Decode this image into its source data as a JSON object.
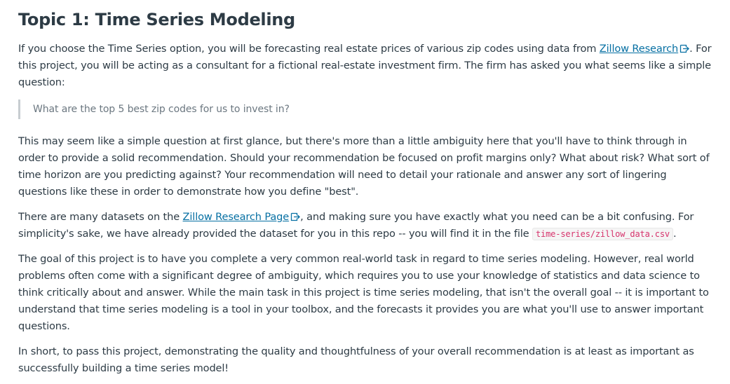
{
  "title": "Topic 1: Time Series Modeling",
  "intro": {
    "before_link": "If you choose the Time Series option, you will be forecasting real estate prices of various zip codes using data from ",
    "link_text": "Zillow Research",
    "after_link": ". For this project, you will be acting as a consultant for a fictional real-estate investment firm. The firm has asked you what seems like a simple question:"
  },
  "quote": "What are the top 5 best zip codes for us to invest in?",
  "paragraph_ambiguity": "This may seem like a simple question at first glance, but there's more than a little ambiguity here that you'll have to think through in order to provide a solid recommendation. Should your recommendation be focused on profit margins only? What about risk? What sort of time horizon are you predicting against? Your recommendation will need to detail your rationale and answer any sort of lingering questions like these in order to demonstrate how you define \"best\".",
  "datasets": {
    "before_link": "There are many datasets on the ",
    "link_text": "Zillow Research Page",
    "after_link": ", and making sure you have exactly what you need can be a bit confusing. For simplicity's sake, we have already provided the dataset for you in this repo -- you will find it in the file ",
    "code": "time-series/zillow_data.csv",
    "end": "."
  },
  "paragraph_goal": "The goal of this project is to have you complete a very common real-world task in regard to time series modeling. However, real world problems often come with a significant degree of ambiguity, which requires you to use your knowledge of statistics and data science to think critically about and answer. While the main task in this project is time series modeling, that isn't the overall goal -- it is important to understand that time series modeling is a tool in your toolbox, and the forecasts it provides you are what you'll use to answer important questions.",
  "paragraph_short": "In short, to pass this project, demonstrating the quality and thoughtfulness of your overall recommendation is at least as important as successfully building a time series model!",
  "icons": {
    "external_link": "external-link-icon"
  },
  "colors": {
    "text": "#2d3b45",
    "link": "#0770a3",
    "quote_text": "#6b7780",
    "quote_border": "#c7cdd1",
    "code_text": "#d6336c"
  }
}
